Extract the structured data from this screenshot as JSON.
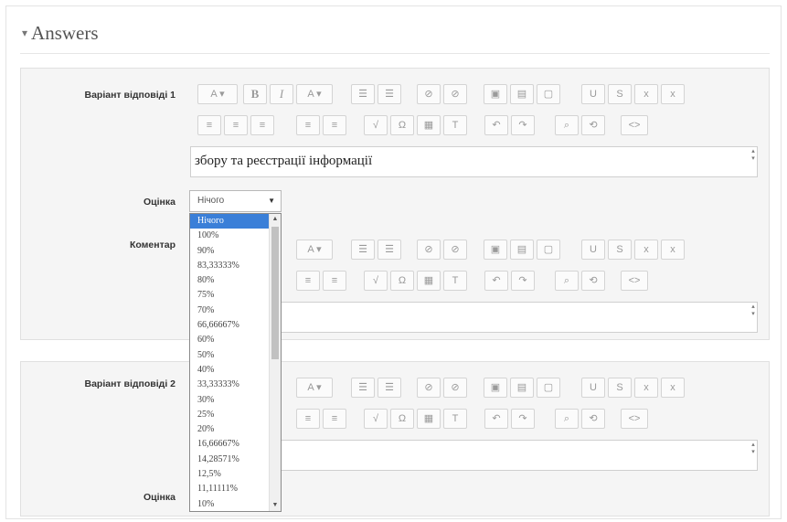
{
  "section": {
    "title": "Answers",
    "toggle_icon": "triangle-down-icon"
  },
  "answer1": {
    "label": "Варіант відповіді 1",
    "text": "збору та реєстрації інформації",
    "grade_label": "Оцінка",
    "comment_label": "Коментар"
  },
  "answer2": {
    "label": "Варіант відповіді 2",
    "grade_label": "Оцінка"
  },
  "select": {
    "value": "Нічого",
    "options": [
      "Нічого",
      "100%",
      "90%",
      "83,33333%",
      "80%",
      "75%",
      "70%",
      "66,66667%",
      "60%",
      "50%",
      "40%",
      "33,33333%",
      "30%",
      "25%",
      "20%",
      "16,66667%",
      "14,28571%",
      "12,5%",
      "11,11111%",
      "10%"
    ]
  },
  "toolbar": {
    "row1": [
      "A",
      "B",
      "I",
      "A",
      "≡",
      "≡",
      "🔗",
      "⛓",
      "▣",
      "▤",
      "▢",
      "U",
      "S",
      "x",
      "x"
    ],
    "row2": [
      "≡",
      "≡",
      "≡",
      "≡",
      "≡",
      "√",
      "Ω",
      "▦",
      "T",
      "↶",
      "↷",
      "⌕",
      "⟲",
      "<>"
    ]
  }
}
